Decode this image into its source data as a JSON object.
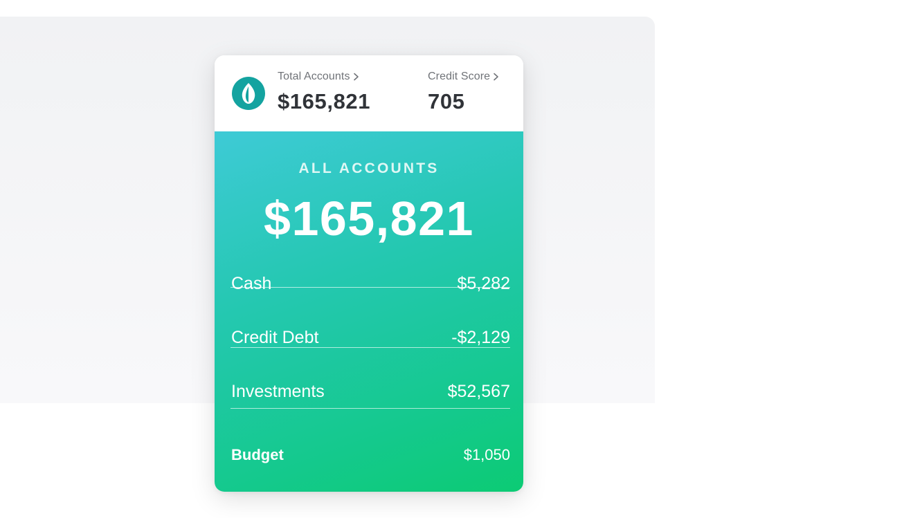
{
  "header": {
    "total_accounts_label": "Total Accounts",
    "total_accounts_value": "$165,821",
    "credit_score_label": "Credit Score",
    "credit_score_value": "705"
  },
  "summary": {
    "title": "ALL ACCOUNTS",
    "total": "$165,821"
  },
  "accounts": [
    {
      "label": "Cash",
      "amount": "$5,282"
    },
    {
      "label": "Credit Debt",
      "amount": "-$2,129"
    },
    {
      "label": "Investments",
      "amount": "$52,567"
    },
    {
      "label": "Budget",
      "amount": "$1,050"
    }
  ],
  "icons": {
    "logo": "leaf-logo-icon",
    "chevron": "chevron-right-icon"
  },
  "colors": {
    "logo_teal": "#14a3a0",
    "gradient_start": "#3ecad6",
    "gradient_end": "#0ccb74",
    "label_gray": "#707378",
    "value_dark": "#303338"
  }
}
